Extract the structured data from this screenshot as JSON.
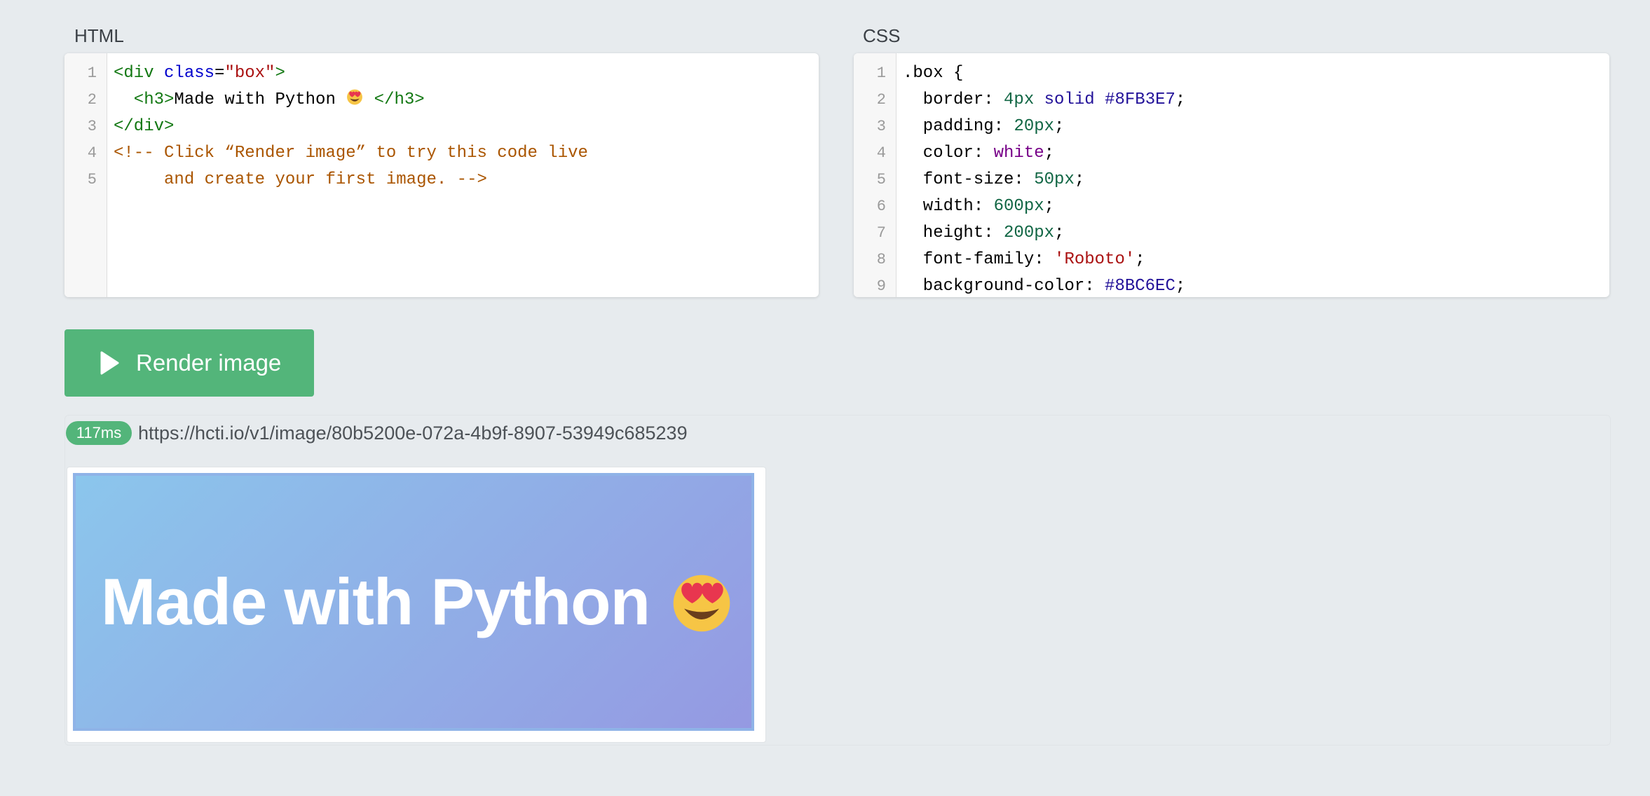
{
  "panels": {
    "html_label": "HTML",
    "css_label": "CSS"
  },
  "html_editor": {
    "lines": [
      {
        "n": "1",
        "parts": [
          [
            "tag",
            "<div "
          ],
          [
            "attr",
            "class"
          ],
          [
            "plain",
            "="
          ],
          [
            "str",
            "\"box\""
          ],
          [
            "tag",
            ">"
          ]
        ]
      },
      {
        "n": "2",
        "parts": [
          [
            "tag",
            "  <h3>"
          ],
          [
            "plain",
            "Made with Python "
          ],
          [
            "emoji",
            "heart-eyes"
          ],
          [
            "tag",
            " </h3>"
          ]
        ]
      },
      {
        "n": "3",
        "parts": [
          [
            "tag",
            "</div>"
          ]
        ]
      },
      {
        "n": "4",
        "parts": [
          [
            "cmt",
            "<!-- Click “Render image” to try this code live"
          ]
        ]
      },
      {
        "n": "5",
        "parts": [
          [
            "cmt",
            "     and create your first image. -->"
          ]
        ]
      }
    ]
  },
  "css_editor": {
    "lines": [
      {
        "n": "1",
        "parts": [
          [
            "plain",
            ".box {"
          ]
        ]
      },
      {
        "n": "2",
        "parts": [
          [
            "prop",
            "  border: "
          ],
          [
            "num",
            "4px"
          ],
          [
            "plain",
            " "
          ],
          [
            "atom",
            "solid"
          ],
          [
            "plain",
            " "
          ],
          [
            "kw",
            "#8FB3E7"
          ],
          [
            "plain",
            ";"
          ]
        ]
      },
      {
        "n": "3",
        "parts": [
          [
            "prop",
            "  padding: "
          ],
          [
            "num",
            "20px"
          ],
          [
            "plain",
            ";"
          ]
        ]
      },
      {
        "n": "4",
        "parts": [
          [
            "prop",
            "  color: "
          ],
          [
            "kwp",
            "white"
          ],
          [
            "plain",
            ";"
          ]
        ]
      },
      {
        "n": "5",
        "parts": [
          [
            "prop",
            "  font-size: "
          ],
          [
            "num",
            "50px"
          ],
          [
            "plain",
            ";"
          ]
        ]
      },
      {
        "n": "6",
        "parts": [
          [
            "prop",
            "  width: "
          ],
          [
            "num",
            "600px"
          ],
          [
            "plain",
            ";"
          ]
        ]
      },
      {
        "n": "7",
        "parts": [
          [
            "prop",
            "  height: "
          ],
          [
            "num",
            "200px"
          ],
          [
            "plain",
            ";"
          ]
        ]
      },
      {
        "n": "8",
        "parts": [
          [
            "prop",
            "  font-family: "
          ],
          [
            "str",
            "'Roboto'"
          ],
          [
            "plain",
            ";"
          ]
        ]
      },
      {
        "n": "9",
        "parts": [
          [
            "prop",
            "  background-color: "
          ],
          [
            "kw",
            "#8BC6EC"
          ],
          [
            "plain",
            ";"
          ]
        ]
      }
    ]
  },
  "render_button": {
    "label": "Render image",
    "icon": "play-icon",
    "color": "#53b57a"
  },
  "result": {
    "time_badge": "117ms",
    "url": "https://hcti.io/v1/image/80b5200e-072a-4b9f-8907-53949c685239",
    "preview_text": "Made with Python",
    "preview_emoji": "heart-eyes-emoji",
    "border_color": "#8FB3E7",
    "gradient_from": "#8BC6EC",
    "gradient_to": "#9599E2"
  }
}
